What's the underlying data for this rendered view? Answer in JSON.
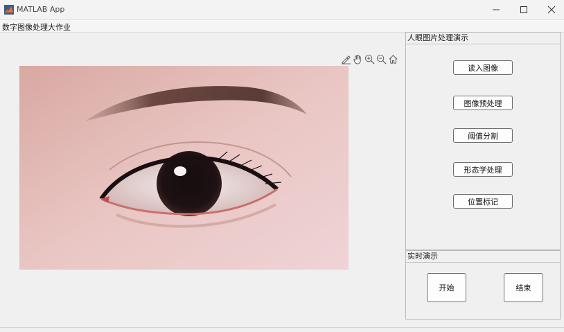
{
  "window": {
    "title": "MATLAB App",
    "menu_title": "数字图像处理大作业",
    "controls": [
      "minimize-icon",
      "maximize-icon",
      "close-icon"
    ]
  },
  "axes_toolbar": {
    "icons": [
      "brush-icon",
      "pan-hand-icon",
      "zoom-in-icon",
      "zoom-out-icon",
      "home-icon"
    ]
  },
  "image": {
    "subject": "eye-photo"
  },
  "panel_processing": {
    "title": "人眼图片处理演示",
    "buttons": [
      "读入图像",
      "图像预处理",
      "阈值分割",
      "形态学处理",
      "位置标记"
    ]
  },
  "panel_realtime": {
    "title": "实时演示",
    "buttons": [
      "开始",
      "结束"
    ]
  }
}
